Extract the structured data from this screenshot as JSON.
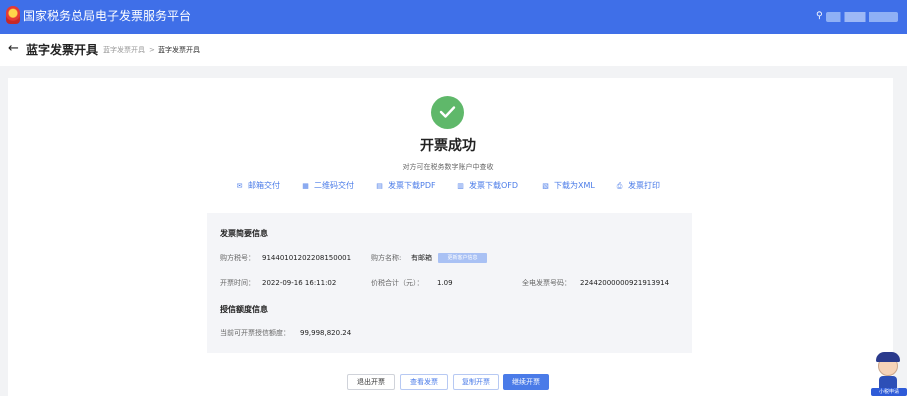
{
  "app": {
    "brand": "国家税务总局电子发票服务平台",
    "logo_icon": "tax-emblem-icon",
    "user_icon": "user-icon"
  },
  "header": {
    "back_icon": "←",
    "title": "蓝字发票开具",
    "breadcrumb": [
      "蓝字发票开具",
      "蓝字发票开具"
    ],
    "breadcrumb_separator": ">"
  },
  "success": {
    "title": "开票成功",
    "subtitle": "对方可在税务数字账户中查收",
    "check_icon": "check-icon",
    "check_color": "#5fb86a"
  },
  "actions": [
    {
      "icon": "mail-icon",
      "label": "邮箱交付"
    },
    {
      "icon": "qrcode-icon",
      "label": "二维码交付"
    },
    {
      "icon": "pdf-icon",
      "label": "发票下载PDF"
    },
    {
      "icon": "ofd-icon",
      "label": "发票下载OFD"
    },
    {
      "icon": "xml-icon",
      "label": "下载为XML"
    },
    {
      "icon": "print-icon",
      "label": "发票打印"
    }
  ],
  "invoice_info": {
    "section_title": "发票简要信息",
    "buyer_tax_id_label": "购方税号：",
    "buyer_tax_id": "91440101202208150001",
    "buyer_name_label": "购方名称:",
    "buyer_name": "有邮箱",
    "update_customer_label": "更新客户信息",
    "issue_time_label": "开票时间：",
    "issue_time": "2022-09-16 16:11:02",
    "total_label": "价税合计（元）：",
    "total": "1.09",
    "invoice_no_label": "全电发票号码：",
    "invoice_no": "22442000000921913914"
  },
  "credit_info": {
    "section_title": "授信额度信息",
    "available_label": "当前可开票授信额度：",
    "available": "99,998,820.24"
  },
  "buttons": {
    "exit": "退出开票",
    "view": "查看发票",
    "copy": "复制开票",
    "continue": "继续开票"
  },
  "assistant": {
    "badge": "小税申请"
  },
  "colors": {
    "header_bg": "#3f6fe8",
    "accent": "#4a7be8",
    "success": "#5fb86a"
  }
}
